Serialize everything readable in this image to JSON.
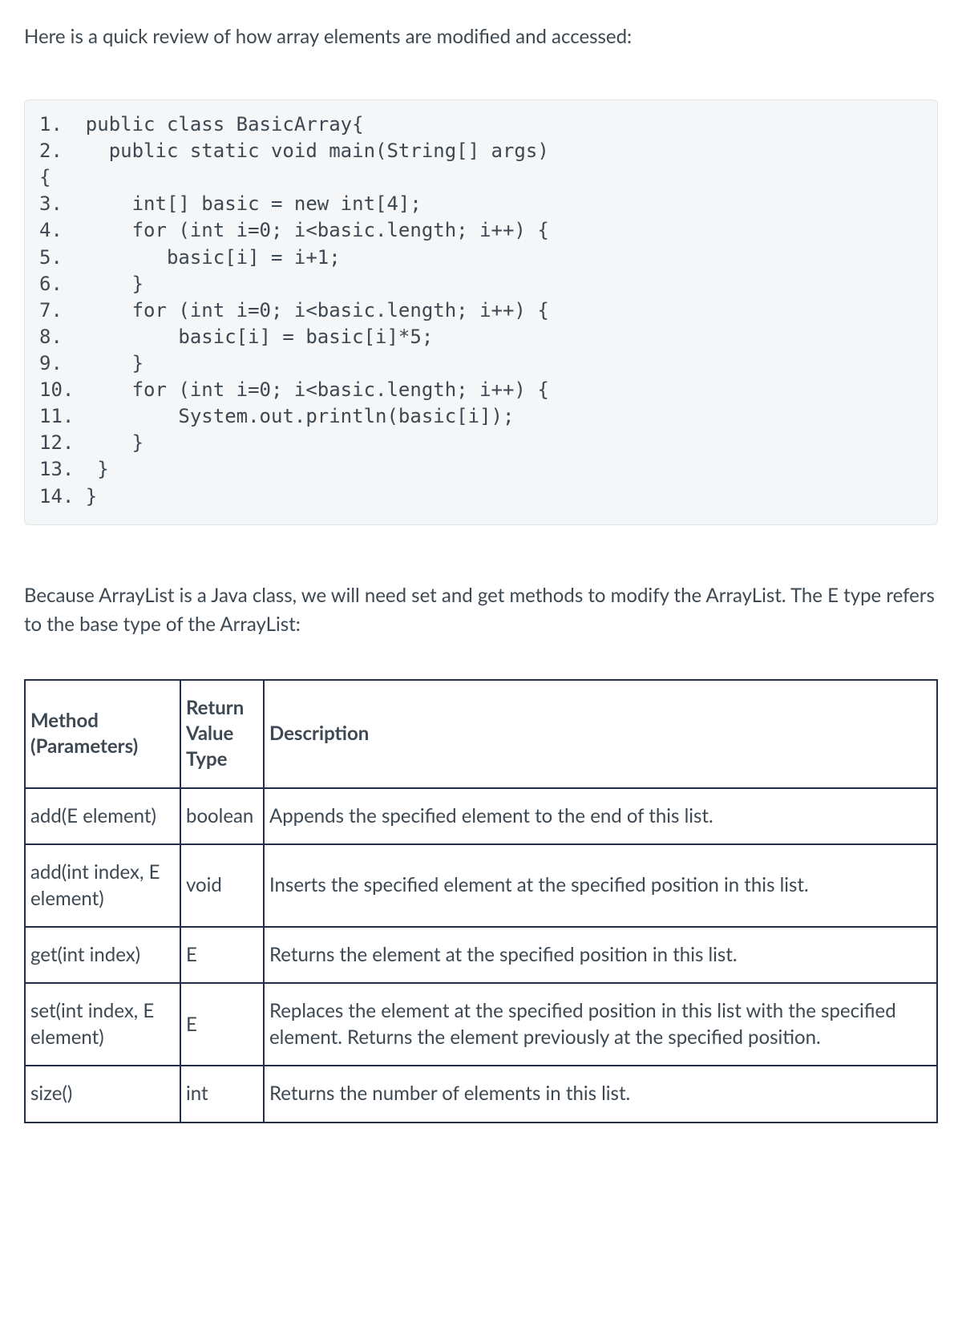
{
  "intro_paragraph": "Here is a quick review of how array elements are modified and accessed:",
  "code": "1.  public class BasicArray{\n2.    public static void main(String[] args)\n{\n3.      int[] basic = new int[4];\n4.      for (int i=0; i<basic.length; i++) {\n5.         basic[i] = i+1;\n6.      }\n7.      for (int i=0; i<basic.length; i++) {\n8.          basic[i] = basic[i]*5;\n9.      }\n10.     for (int i=0; i<basic.length; i++) {\n11.         System.out.println(basic[i]);\n12.     }\n13.  }\n14. }",
  "middle_paragraph": "Because ArrayList is a Java class, we will need set and get methods to modify the ArrayList. The E type refers to the base type of the ArrayList:",
  "table": {
    "headers": {
      "method": "Method (Parameters)",
      "return": "Return Value Type",
      "description": "Description"
    },
    "rows": [
      {
        "method": "add(E element)",
        "return": "boolean",
        "description": "Appends the specified element to the end of this list."
      },
      {
        "method": "add(int index, E element)",
        "return": "void",
        "description": "Inserts the specified element at the specified position in this list."
      },
      {
        "method": "get(int index)",
        "return": "E",
        "description": "Returns the element at the specified position in this list."
      },
      {
        "method": "set(int index, E element)",
        "return": "E",
        "description": "Replaces the element at the specified position in this list with the specified element. Returns the element previously at the specified position."
      },
      {
        "method": "size()",
        "return": "int",
        "description": "Returns the number of elements in this list."
      }
    ]
  }
}
